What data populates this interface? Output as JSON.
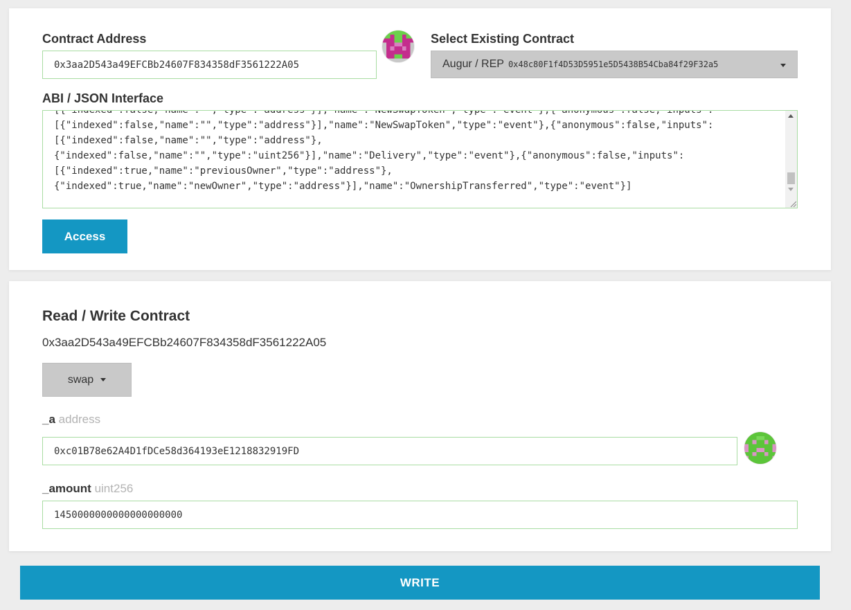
{
  "contract_address": {
    "label": "Contract Address",
    "value": "0x3aa2D543a49EFCBb24607F834358dF3561222A05"
  },
  "existing_contract": {
    "label": "Select Existing Contract",
    "selected_name": "Augur / REP",
    "selected_address": "0x48c80F1f4D53D5951e5D5438B54Cba84f29F32a5"
  },
  "abi": {
    "label": "ABI / JSON Interface",
    "text": "[{\"indexed\":false,\"name\":\"\",\"type\":\"address\"}],\"name\":\"NewSwapToken\",\"type\":\"event\"},{\"anonymous\":false,\"inputs\":\n[{\"indexed\":false,\"name\":\"\",\"type\":\"address\"}],\"name\":\"NewSwapToken\",\"type\":\"event\"},{\"anonymous\":false,\"inputs\":\n[{\"indexed\":false,\"name\":\"\",\"type\":\"address\"},\n{\"indexed\":false,\"name\":\"\",\"type\":\"uint256\"}],\"name\":\"Delivery\",\"type\":\"event\"},{\"anonymous\":false,\"inputs\":\n[{\"indexed\":true,\"name\":\"previousOwner\",\"type\":\"address\"},\n{\"indexed\":true,\"name\":\"newOwner\",\"type\":\"address\"}],\"name\":\"OwnershipTransferred\",\"type\":\"event\"}]"
  },
  "access_button": "Access",
  "read_write": {
    "title": "Read / Write Contract",
    "address": "0x3aa2D543a49EFCBb24607F834358dF3561222A05",
    "function_selected": "swap",
    "params": [
      {
        "name": "_a",
        "type": "address",
        "value": "0xc01B78e62A4D1fDCe58d364193eE1218832919FD"
      },
      {
        "name": "_amount",
        "type": "uint256",
        "value": "1450000000000000000000"
      }
    ]
  },
  "write_button": "WRITE",
  "colors": {
    "accent": "#1497c3",
    "input_border": "#a8dca2",
    "dropdown_bg": "#c9c9c9",
    "page_bg": "#ededed"
  },
  "icons": [
    "identicon-contract",
    "identicon-param-address",
    "caret-down-icon",
    "scroll-up-arrow-icon",
    "scroll-down-arrow-icon",
    "resize-grip-icon"
  ]
}
